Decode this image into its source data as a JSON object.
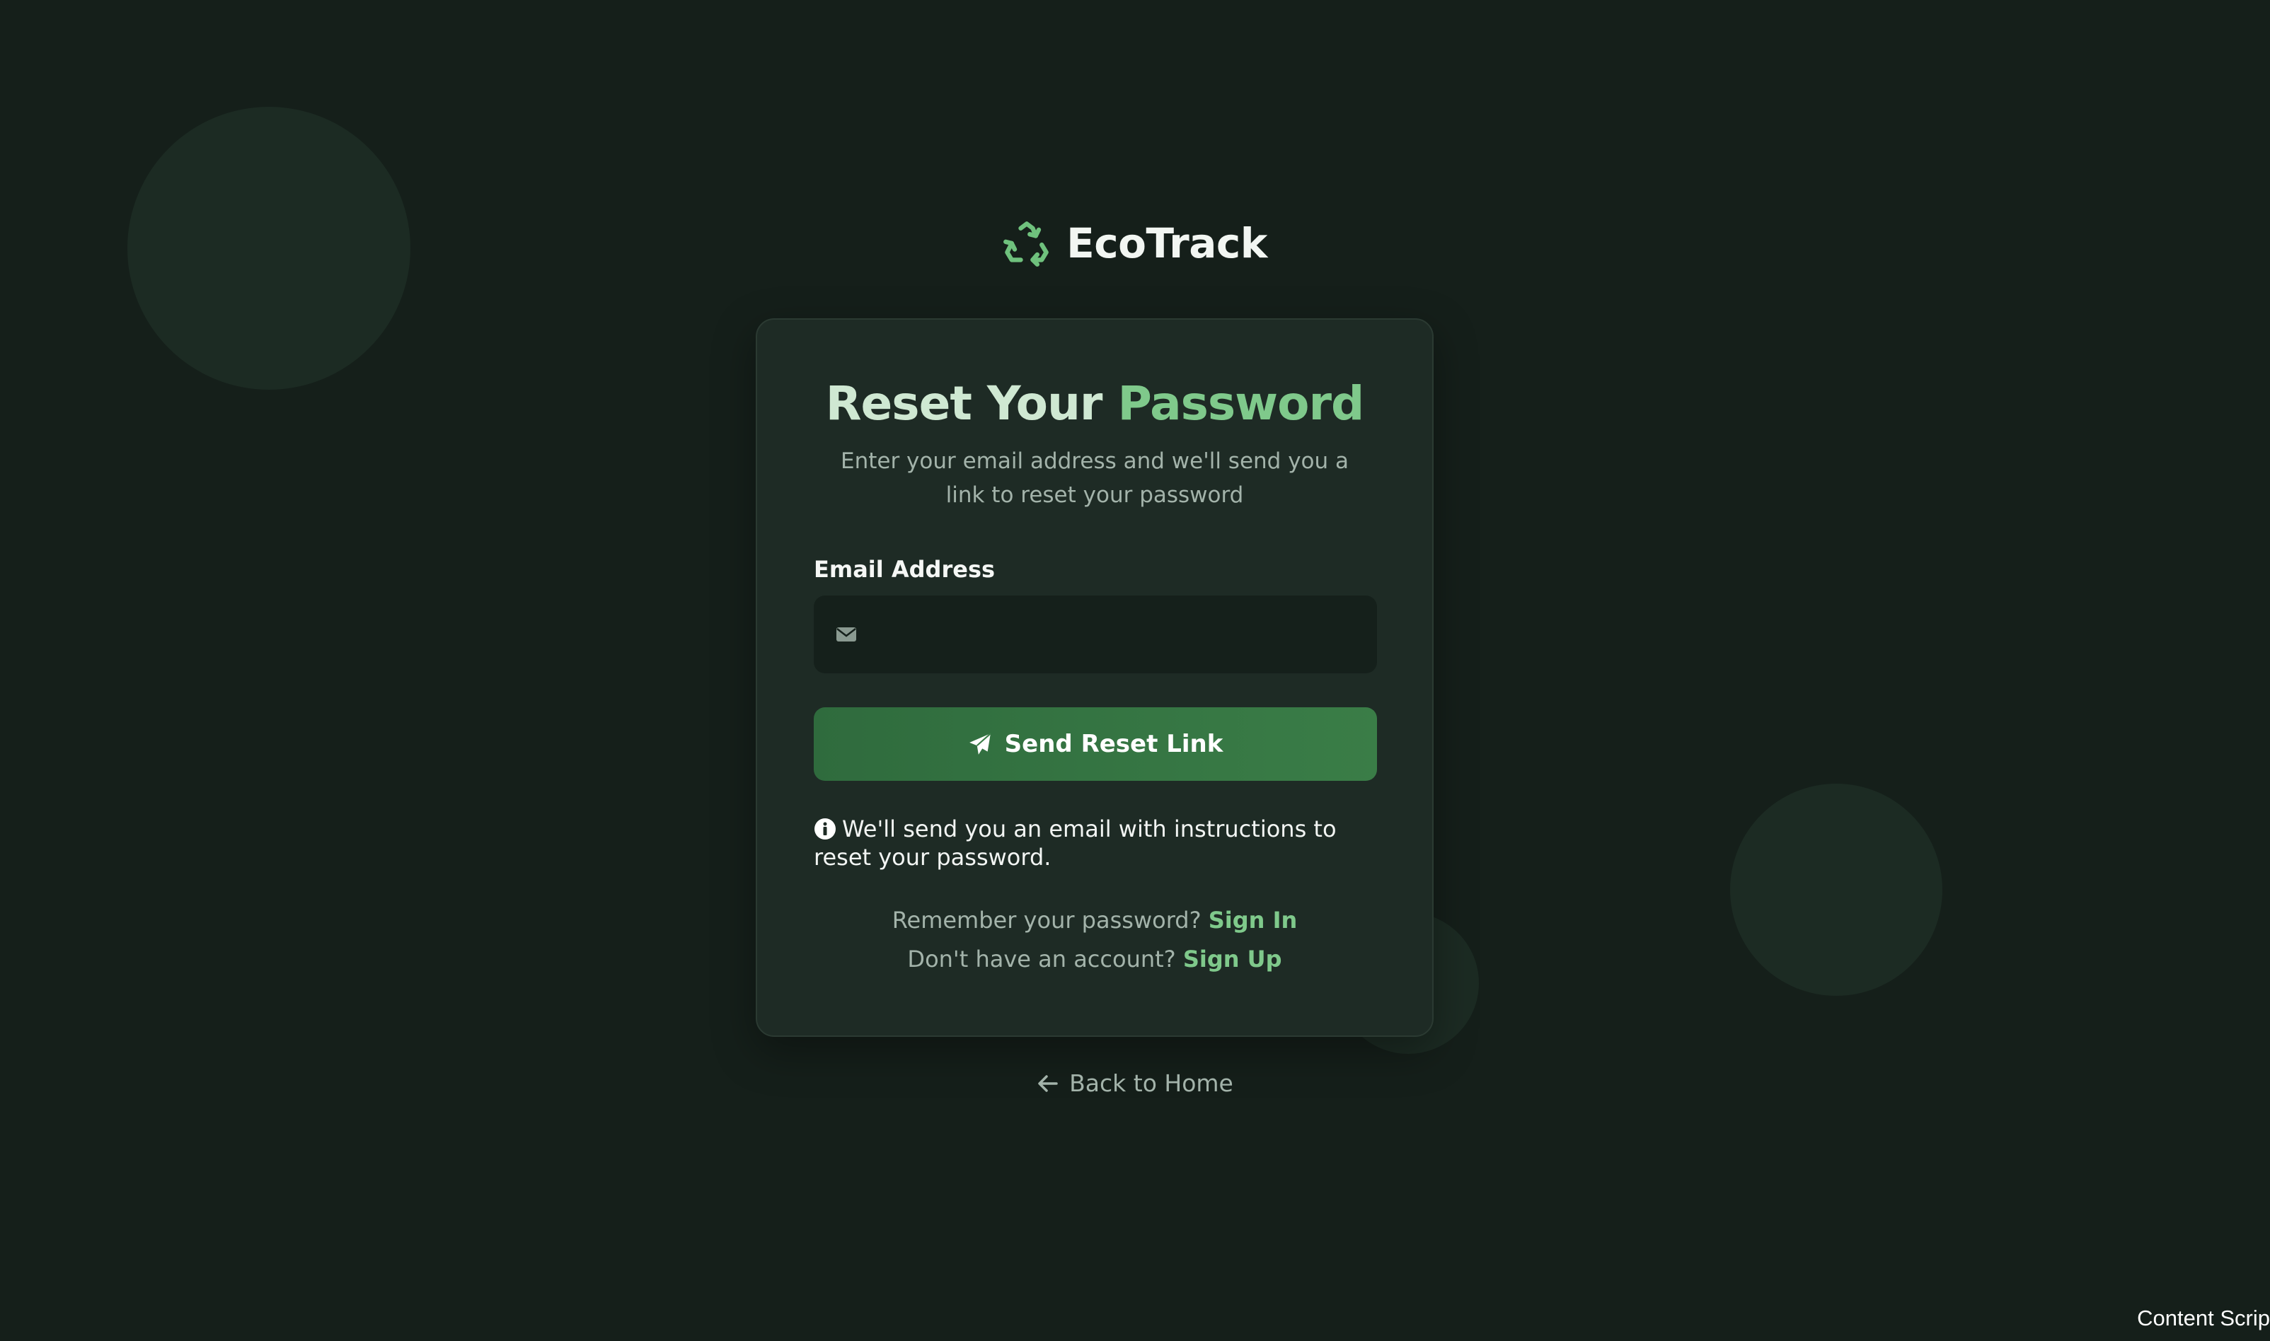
{
  "brand": {
    "name": "EcoTrack",
    "icon": "recycle-icon"
  },
  "card": {
    "title_part1": "Reset Your",
    "title_part2": "Password",
    "subtitle": "Enter your email address and we'll send you a link to reset your password",
    "email_label": "Email Address",
    "email_value": "",
    "email_placeholder": "",
    "email_icon": "envelope-icon",
    "send_button_label": "Send Reset Link",
    "send_button_icon": "paper-plane-icon",
    "info_icon": "info-circle-icon",
    "info_text": "We'll send you an email with instructions to reset your password.",
    "remember_text": "Remember your password?",
    "sign_in_link": "Sign In",
    "no_account_text": "Don't have an account?",
    "sign_up_link": "Sign Up"
  },
  "back_link": {
    "label": "Back to Home",
    "icon": "arrow-left-icon"
  },
  "overlay": {
    "corner_text": "Content Scrip"
  },
  "colors": {
    "background": "#151f1a",
    "card": "#1e2b25",
    "accent": "#7fc98b",
    "button": "#3a7d47"
  }
}
